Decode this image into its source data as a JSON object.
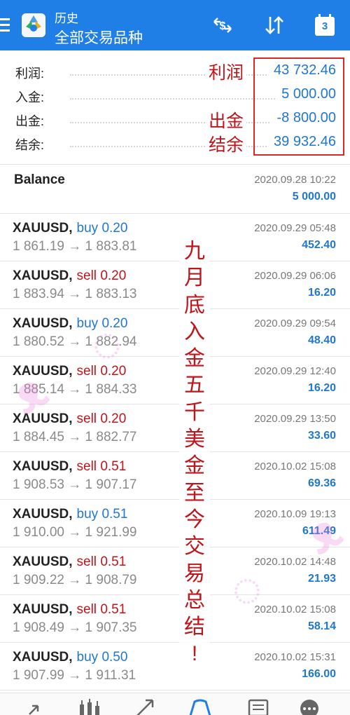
{
  "header": {
    "subtitle": "历史",
    "title": "全部交易品种",
    "calendar_day": "3"
  },
  "summary": {
    "rows": [
      {
        "label": "利润:",
        "value": "43 732.46"
      },
      {
        "label": "入金:",
        "value": "5 000.00"
      },
      {
        "label": "出金:",
        "value": "-8 800.00"
      },
      {
        "label": "结余:",
        "value": "39 932.46"
      }
    ],
    "annotations": {
      "profit": "利润",
      "withdrawal": "出金",
      "balance": "结余"
    }
  },
  "balance_entry": {
    "label": "Balance",
    "date": "2020.09.28 10:22",
    "amount": "5 000.00"
  },
  "trades": [
    {
      "symbol": "XAUUSD,",
      "side": "buy",
      "lots": "0.20",
      "open": "1 861.19",
      "close": "1 883.81",
      "date": "2020.09.29 05:48",
      "profit": "452.40"
    },
    {
      "symbol": "XAUUSD,",
      "side": "sell",
      "lots": "0.20",
      "open": "1 883.94",
      "close": "1 883.13",
      "date": "2020.09.29 06:06",
      "profit": "16.20"
    },
    {
      "symbol": "XAUUSD,",
      "side": "buy",
      "lots": "0.20",
      "open": "1 880.52",
      "close": "1 882.94",
      "date": "2020.09.29 09:54",
      "profit": "48.40"
    },
    {
      "symbol": "XAUUSD,",
      "side": "sell",
      "lots": "0.20",
      "open": "1 885.14",
      "close": "1 884.33",
      "date": "2020.09.29 12:40",
      "profit": "16.20"
    },
    {
      "symbol": "XAUUSD,",
      "side": "sell",
      "lots": "0.20",
      "open": "1 884.45",
      "close": "1 882.77",
      "date": "2020.09.29 13:50",
      "profit": "33.60"
    },
    {
      "symbol": "XAUUSD,",
      "side": "sell",
      "lots": "0.51",
      "open": "1 908.53",
      "close": "1 907.17",
      "date": "2020.10.02 15:08",
      "profit": "69.36"
    },
    {
      "symbol": "XAUUSD,",
      "side": "buy",
      "lots": "0.51",
      "open": "1 910.00",
      "close": "1 921.99",
      "date": "2020.10.09 19:13",
      "profit": "611.49"
    },
    {
      "symbol": "XAUUSD,",
      "side": "sell",
      "lots": "0.51",
      "open": "1 909.22",
      "close": "1 908.79",
      "date": "2020.10.02 14:48",
      "profit": "21.93"
    },
    {
      "symbol": "XAUUSD,",
      "side": "sell",
      "lots": "0.51",
      "open": "1 908.49",
      "close": "1 907.35",
      "date": "2020.10.02 15:08",
      "profit": "58.14"
    },
    {
      "symbol": "XAUUSD,",
      "side": "buy",
      "lots": "0.50",
      "open": "1 907.99",
      "close": "1 911.31",
      "date": "2020.10.02 15:31",
      "profit": "166.00"
    }
  ],
  "vertical_annotation": [
    "九",
    "月",
    "底",
    "入",
    "金",
    "五",
    "千",
    "美",
    "金",
    "至",
    "今",
    "交",
    "易",
    "总",
    "结",
    "!"
  ],
  "arrow": "→",
  "colors": {
    "header": "#1f7fe6",
    "buy": "#1f77d0",
    "sell": "#c0141b",
    "annotation": "#c0141b"
  },
  "icons": [
    "menu-icon",
    "app-logo-icon",
    "currency-exchange-icon",
    "sort-icon",
    "calendar-icon",
    "quotes-icon",
    "chart-icon",
    "trade-icon",
    "history-icon",
    "messages-icon",
    "more-icon"
  ]
}
